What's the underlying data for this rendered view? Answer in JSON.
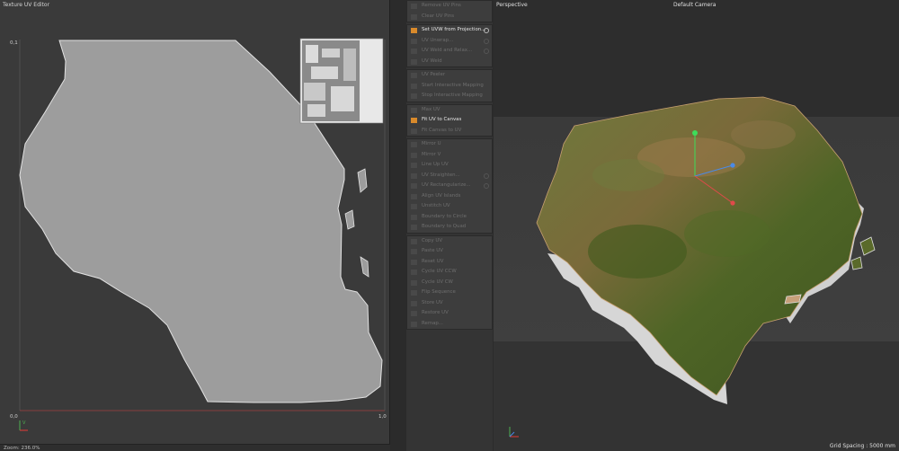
{
  "uv_editor": {
    "title": "Texture UV Editor",
    "axis_top": "0,1",
    "axis_origin": "0,0",
    "axis_right": "1,0",
    "axis_v": "V",
    "zoom": "Zoom: 236.0%"
  },
  "palette": {
    "groups": [
      [
        {
          "label": "Remove UV Pins",
          "enabled": false,
          "gear": false
        },
        {
          "label": "Clear UV Pins",
          "enabled": false,
          "gear": false
        }
      ],
      [
        {
          "label": "Set UVW from Projection...",
          "enabled": true,
          "gear": true
        },
        {
          "label": "UV Unwrap...",
          "enabled": false,
          "gear": true
        },
        {
          "label": "UV Weld and Relax...",
          "enabled": false,
          "gear": true
        },
        {
          "label": "UV Weld",
          "enabled": false,
          "gear": false
        }
      ],
      [
        {
          "label": "UV Peeler",
          "enabled": false,
          "gear": false
        },
        {
          "label": "Start Interactive Mapping",
          "enabled": false,
          "gear": false
        },
        {
          "label": "Stop Interactive Mapping",
          "enabled": false,
          "gear": false
        }
      ],
      [
        {
          "label": "Max UV",
          "enabled": false,
          "gear": false
        },
        {
          "label": "Fit UV to Canvas",
          "enabled": true,
          "gear": false
        },
        {
          "label": "Fit Canvas to UV",
          "enabled": false,
          "gear": false
        }
      ],
      [
        {
          "label": "Mirror U",
          "enabled": false,
          "gear": false
        },
        {
          "label": "Mirror V",
          "enabled": false,
          "gear": false
        },
        {
          "label": "Line Up UV",
          "enabled": false,
          "gear": false
        },
        {
          "label": "UV Straighten...",
          "enabled": false,
          "gear": true
        },
        {
          "label": "UV Rectangularize...",
          "enabled": false,
          "gear": true
        },
        {
          "label": "Align UV Islands",
          "enabled": false,
          "gear": false
        },
        {
          "label": "Unstitch UV",
          "enabled": false,
          "gear": false
        },
        {
          "label": "Boundary to Circle",
          "enabled": false,
          "gear": false
        },
        {
          "label": "Boundary to Quad",
          "enabled": false,
          "gear": false
        }
      ],
      [
        {
          "label": "Copy UV",
          "enabled": false,
          "gear": false
        },
        {
          "label": "Paste UV",
          "enabled": false,
          "gear": false
        },
        {
          "label": "Reset UV",
          "enabled": false,
          "gear": false
        },
        {
          "label": "Cycle UV CCW",
          "enabled": false,
          "gear": false
        },
        {
          "label": "Cycle UV CW",
          "enabled": false,
          "gear": false
        },
        {
          "label": "Flip Sequence",
          "enabled": false,
          "gear": false
        },
        {
          "label": "Store UV",
          "enabled": false,
          "gear": false
        },
        {
          "label": "Restore UV",
          "enabled": false,
          "gear": false
        },
        {
          "label": "Remap...",
          "enabled": false,
          "gear": false
        }
      ]
    ]
  },
  "viewport": {
    "title": "Perspective",
    "camera": "Default Camera",
    "grid_spacing": "Grid Spacing : 5000 mm"
  },
  "colors": {
    "uv_fill": "#9d9d9d",
    "accent_orange": "#f5a623",
    "terrain_green": "#5b6a2e"
  }
}
